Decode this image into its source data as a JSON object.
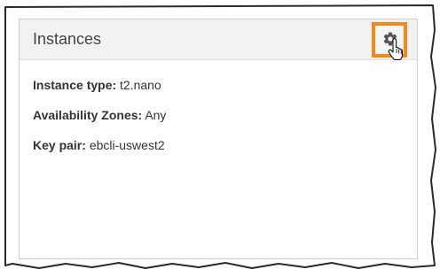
{
  "panel": {
    "title": "Instances",
    "fields": [
      {
        "label": "Instance type:",
        "value": "t2.nano"
      },
      {
        "label": "Availability Zones:",
        "value": "Any"
      },
      {
        "label": "Key pair:",
        "value": "ebcli-uswest2"
      }
    ]
  },
  "icons": {
    "settings": "gear-icon",
    "cursor": "hand-pointer-cursor"
  },
  "colors": {
    "highlight": "#f08a1a",
    "header_bg": "#f2f2f2",
    "border": "#cfcfcf"
  }
}
